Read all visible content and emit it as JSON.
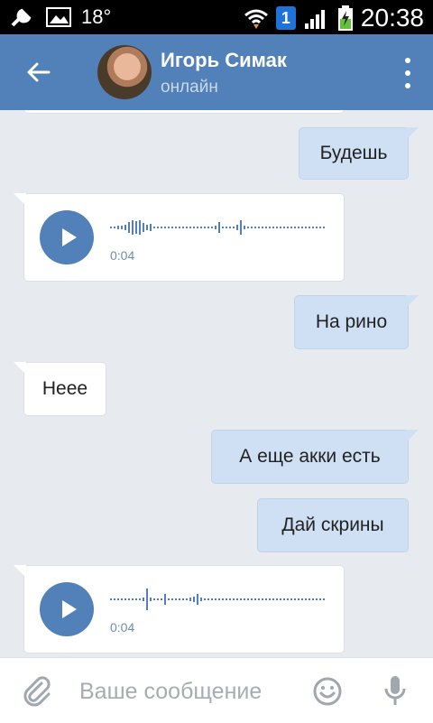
{
  "status_bar": {
    "temperature": "18°",
    "sim_number": "1",
    "time": "20:38"
  },
  "header": {
    "name": "Игорь Симак",
    "status": "онлайн"
  },
  "messages": {
    "m1": "Будешь",
    "m2": "На рино",
    "m3": "Неее",
    "m4": "А еще акки есть",
    "m5": "Дай скрины"
  },
  "voice_messages": {
    "v1": {
      "duration": "0:04"
    },
    "v2": {
      "duration": "0:04"
    }
  },
  "input": {
    "placeholder": "Ваше сообщение"
  },
  "colors": {
    "accent": "#5181b8",
    "bubble_out": "#cfe0f4",
    "bubble_in": "#ffffff",
    "background": "#e7ebf0"
  },
  "icons": [
    "wrench-icon",
    "image-icon",
    "wifi-icon",
    "signal-icon",
    "battery-icon",
    "back-arrow-icon",
    "more-icon",
    "play-icon",
    "paperclip-icon",
    "smile-icon",
    "mic-icon"
  ]
}
